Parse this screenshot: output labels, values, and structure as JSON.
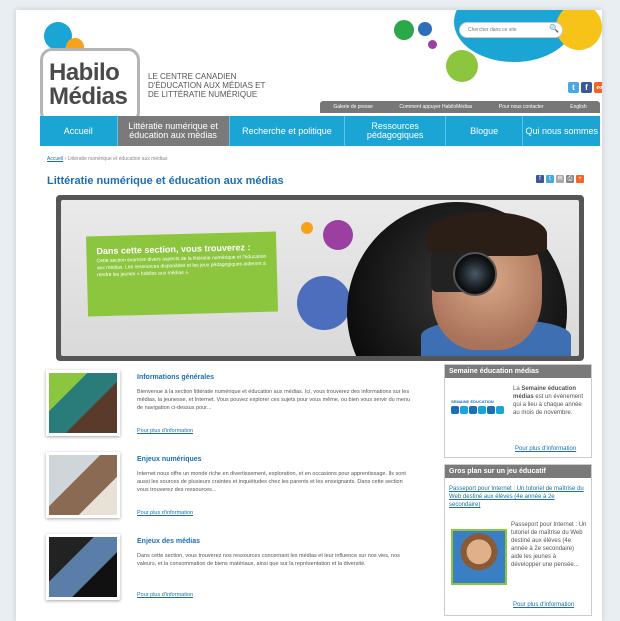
{
  "header": {
    "logo_line1": "Habilo",
    "logo_line2": "Médias",
    "tagline_l1": "LE CENTRE CANADIEN",
    "tagline_l2": "D'ÉDUCATION AUX MÉDIAS ET",
    "tagline_l3": "DE LITTÉRATIE NUMÉRIQUE",
    "search_placeholder": "Chercher dans ce site"
  },
  "top_links": [
    "Galerie de presse",
    "Comment appuyer HabiloMédias",
    "Pour nous contacter",
    "English"
  ],
  "nav": [
    {
      "label": "Accueil"
    },
    {
      "label": "Littératie numérique et éducation aux médias"
    },
    {
      "label": "Recherche et politique"
    },
    {
      "label": "Ressources pédagogiques"
    },
    {
      "label": "Blogue"
    },
    {
      "label": "Qui nous sommes"
    }
  ],
  "breadcrumb": {
    "home": "Accueil",
    "current": "Littératie numérique et éducation aux médias"
  },
  "page_title": "Littératie numérique et éducation aux médias",
  "hero": {
    "heading": "Dans cette section, vous trouverez :",
    "text": "Cette section examine divers aspects de la littératie numérique et l'éducation aux médias. Les ressources disponibles et les jeux pédagogiques aideront à rendre les jeunes « habiles aux médias »."
  },
  "items": [
    {
      "title": "Informations générales",
      "desc": "Bienvenue à la section littératie numérique et éducation aux médias. Ici, vous trouverez des informations sur les médias, la jeunesse, et Internet. Vous pouvez explorer ces sujets pour vous même, ou bien vous servir du menu de navigation ci-dessus pour...",
      "link": "Pour plus d'information"
    },
    {
      "title": "Enjeux numériques",
      "desc": "Internet nous offre un monde riche en divertissement, exploration, et en occasions pour apprentissage. Ils sont aussi les sources de plusieurs craintes et inquiétudes chez les parents et les enseignants. Dans cette section vous trouverez des ressources...",
      "link": "Pour plus d'information"
    },
    {
      "title": "Enjeux des médias",
      "desc": "Dans cette section, vous trouverez nos ressources concernant les médias et leur influence sur nos vies, nos valeurs, et la consommation de biens matériaux, ainsi que sur la représentation et la diversité.",
      "link": "Pour plus d'information"
    }
  ],
  "sidebar": {
    "week": {
      "heading": "Semaine éducation médias",
      "logo_text": "SEMAINE ÉDUCATION",
      "text_pre": "La ",
      "text_bold": "Semaine éducation médias",
      "text_post": " est un événement qui a lieu à chaque année au mois de novembre.",
      "link": "Pour plus d'information"
    },
    "game": {
      "heading": "Gros plan sur un jeu éducatif",
      "title_link": "Passeport pour Internet : Un tutoriel de maîtrise du Web destiné aux élèves (4e année à 2e secondaire)",
      "text": "Passeport pour Internet : Un tutoriel de maîtrise du Web destiné aux élèves (4e année à 2e secondaire) aide les jeunes à développer une pensée...",
      "link": "Pour plus d'information"
    }
  },
  "colors": {
    "nav": "#1aa5d5",
    "active": "#7a7a7a",
    "green": "#8cc63f",
    "link": "#1a6fb4"
  }
}
